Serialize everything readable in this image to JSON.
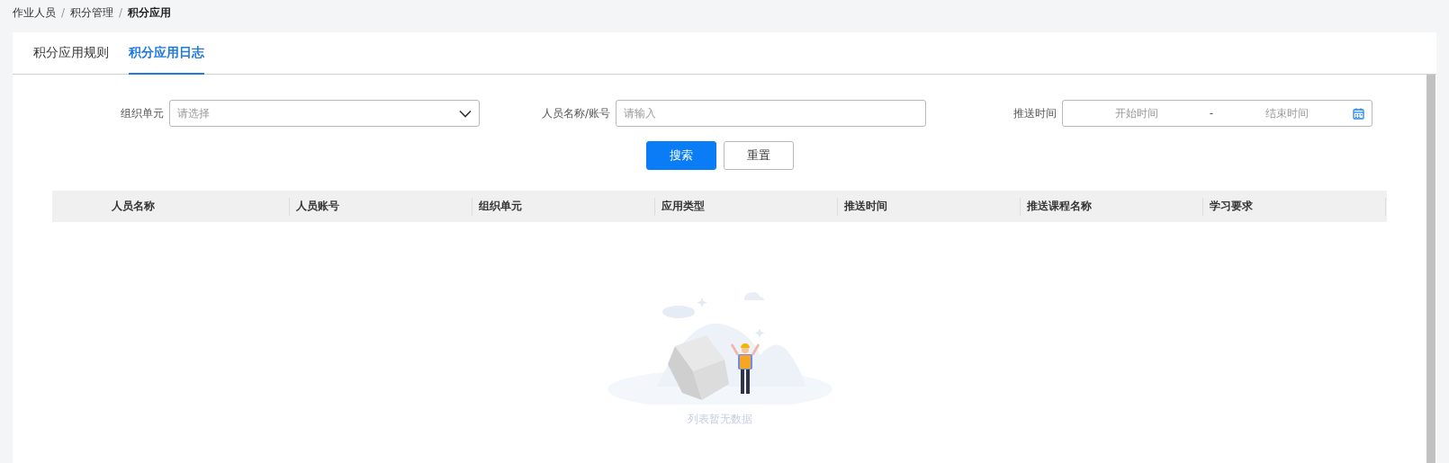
{
  "breadcrumb": {
    "separator": "/",
    "items": [
      {
        "label": "作业人员",
        "current": false
      },
      {
        "label": "积分管理",
        "current": false
      },
      {
        "label": "积分应用",
        "current": true
      }
    ]
  },
  "tabs": [
    {
      "label": "积分应用规则",
      "selected": false
    },
    {
      "label": "积分应用日志",
      "selected": true
    }
  ],
  "filters": [
    {
      "kind": "select",
      "label": "组织单元",
      "placeholder": "请选择"
    },
    {
      "kind": "text",
      "label": "人员名称/账号",
      "placeholder": "请输入"
    },
    {
      "kind": "daterange",
      "label": "推送时间",
      "start_placeholder": "开始时间",
      "separator": "-",
      "end_placeholder": "结束时间"
    }
  ],
  "buttons": [
    {
      "label": "搜索",
      "kind": "primary"
    },
    {
      "label": "重置",
      "kind": "default"
    }
  ],
  "table": {
    "columns": [
      "人员名称",
      "人员账号",
      "组织单元",
      "应用类型",
      "推送时间",
      "推送课程名称",
      "学习要求"
    ],
    "empty_text": "列表暂无数据"
  }
}
